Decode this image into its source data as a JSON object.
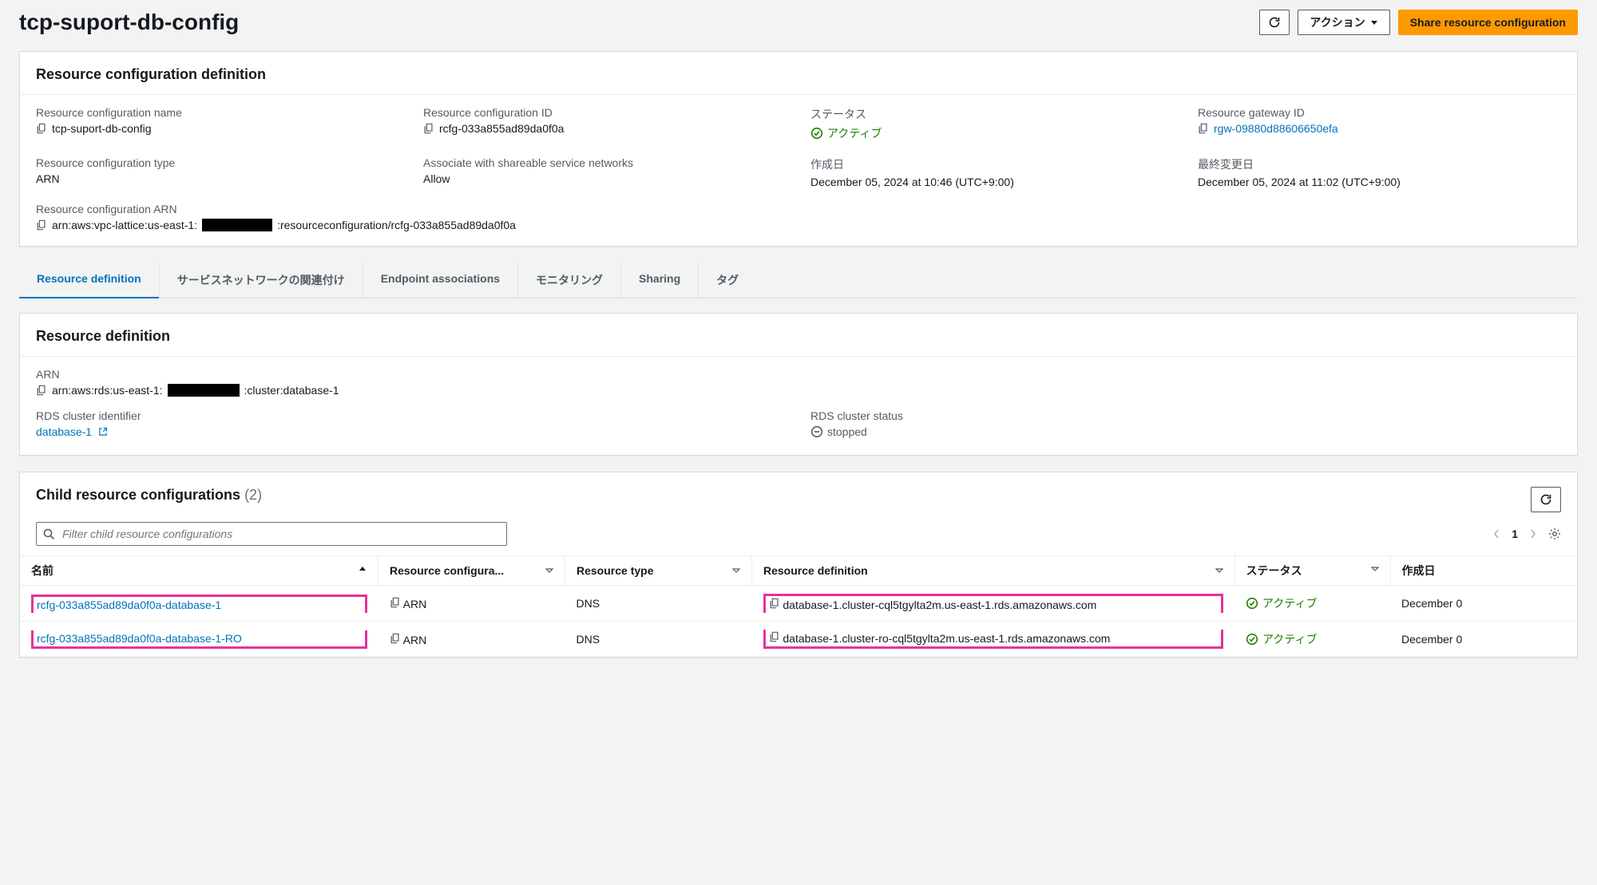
{
  "header": {
    "title": "tcp-suport-db-config",
    "actions_label": "アクション",
    "share_label": "Share resource configuration"
  },
  "definition_panel": {
    "title": "Resource configuration definition",
    "fields": {
      "name_label": "Resource configuration name",
      "name_value": "tcp-suport-db-config",
      "id_label": "Resource configuration ID",
      "id_value": "rcfg-033a855ad89da0f0a",
      "status_label": "ステータス",
      "status_value": "アクティブ",
      "gateway_label": "Resource gateway ID",
      "gateway_value": "rgw-09880d88606650efa",
      "type_label": "Resource configuration type",
      "type_value": "ARN",
      "assoc_label": "Associate with shareable service networks",
      "assoc_value": "Allow",
      "created_label": "作成日",
      "created_value": "December 05, 2024 at 10:46 (UTC+9:00)",
      "modified_label": "最終変更日",
      "modified_value": "December 05, 2024 at 11:02 (UTC+9:00)",
      "arn_label": "Resource configuration ARN",
      "arn_prefix": "arn:aws:vpc-lattice:us-east-1:",
      "arn_suffix": ":resourceconfiguration/rcfg-033a855ad89da0f0a"
    }
  },
  "tabs": [
    {
      "label": "Resource definition",
      "active": true
    },
    {
      "label": "サービスネットワークの関連付け"
    },
    {
      "label": "Endpoint associations"
    },
    {
      "label": "モニタリング"
    },
    {
      "label": "Sharing"
    },
    {
      "label": "タグ"
    }
  ],
  "resource_def_panel": {
    "title": "Resource definition",
    "arn_label": "ARN",
    "arn_prefix": "arn:aws:rds:us-east-1:",
    "arn_suffix": ":cluster:database-1",
    "cluster_id_label": "RDS cluster identifier",
    "cluster_id_value": "database-1",
    "cluster_status_label": "RDS cluster status",
    "cluster_status_value": "stopped"
  },
  "child_panel": {
    "title": "Child resource configurations",
    "count": "(2)",
    "filter_placeholder": "Filter child resource configurations",
    "page": "1",
    "columns": {
      "name": "名前",
      "rc": "Resource configura...",
      "rtype": "Resource type",
      "rdef": "Resource definition",
      "status": "ステータス",
      "created": "作成日"
    },
    "rows": [
      {
        "name": "rcfg-033a855ad89da0f0a-database-1",
        "rc": "ARN",
        "rtype": "DNS",
        "rdef": "database-1.cluster-cql5tgylta2m.us-east-1.rds.amazonaws.com",
        "status": "アクティブ",
        "created": "December 0"
      },
      {
        "name": "rcfg-033a855ad89da0f0a-database-1-RO",
        "rc": "ARN",
        "rtype": "DNS",
        "rdef": "database-1.cluster-ro-cql5tgylta2m.us-east-1.rds.amazonaws.com",
        "status": "アクティブ",
        "created": "December 0"
      }
    ]
  }
}
